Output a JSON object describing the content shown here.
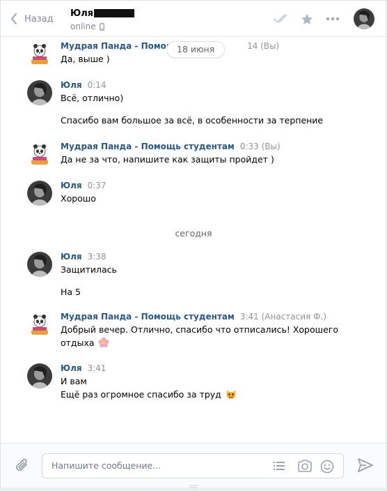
{
  "header": {
    "back_label": "Назад",
    "peer_name": "Юля",
    "peer_status": "online"
  },
  "composer": {
    "placeholder": "Напишите сообщение..."
  },
  "date_pill": "18 июня",
  "date_separator": "сегодня",
  "messages": [
    {
      "author": "Мудрая Панда - Помощь студентам",
      "author_short": "Мудрая Панда - Помощь с",
      "time": "0:14 (Вы)",
      "time_short": "14 (Вы)",
      "text": "Да, выше )"
    },
    {
      "author": "Юля",
      "time": "0:14",
      "text": "Всё, отлично)",
      "text2": "Спасибо вам большое за всё, в особенности за терпение"
    },
    {
      "author": "Мудрая Панда - Помощь студентам",
      "time": "0:33 (Вы)",
      "text": "Да не за что, напишите как защиты пройдет )"
    },
    {
      "author": "Юля",
      "time": "0:37",
      "text": "Хорошо"
    },
    {
      "author": "Юля",
      "time": "3:38",
      "text": "Защитилась",
      "text2": "На 5"
    },
    {
      "author": "Мудрая Панда - Помощь студентам",
      "time": "3:41 (Анастасия Ф.)",
      "text_line1": "Добрый вечер. Отлично, спасибо что отписались! Хорошего",
      "text_line2": "отдыха"
    },
    {
      "author": "Юля",
      "time": "3:41",
      "text": "И вам",
      "text2": "Ещё раз огромное спасибо за труд"
    }
  ],
  "icons": {
    "back": "chevron-left-icon",
    "read": "double-check-icon",
    "star": "star-icon",
    "more": "more-icon",
    "attach": "paperclip-icon",
    "templates": "list-icon",
    "camera": "camera-icon",
    "emoji": "smile-icon",
    "send": "send-icon"
  },
  "colors": {
    "author": "#2a5885",
    "meta": "#939393",
    "icon": "#828a99"
  }
}
